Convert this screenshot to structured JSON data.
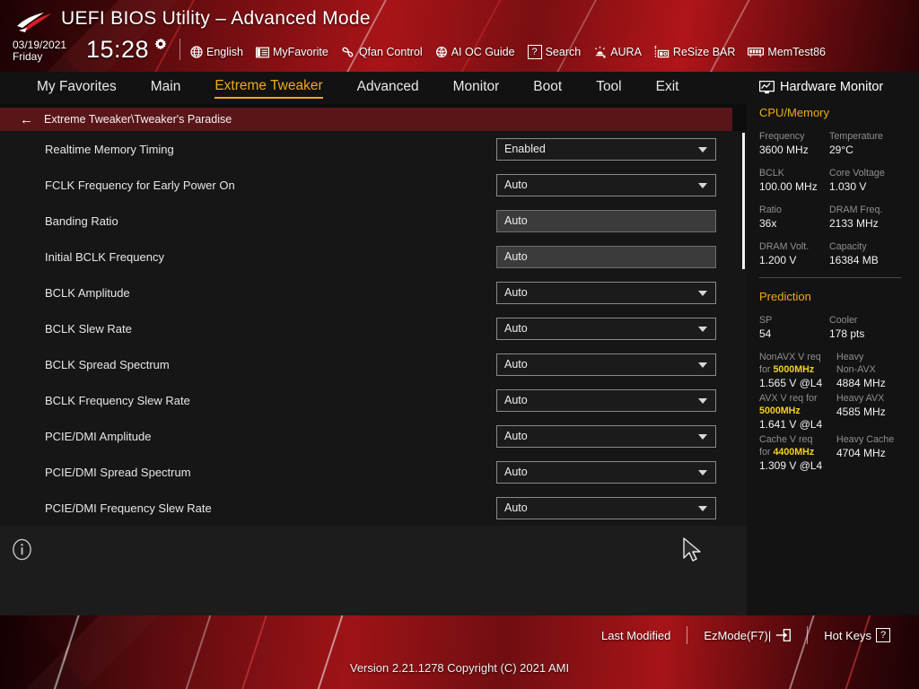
{
  "header": {
    "title": "UEFI BIOS Utility – Advanced Mode",
    "date": "03/19/2021",
    "weekday": "Friday",
    "time": "15:28",
    "logo_name": "rog-logo",
    "gear_icon": "gear-icon",
    "toolbar": [
      {
        "label": "English",
        "icon": "globe-icon"
      },
      {
        "label": "MyFavorite",
        "icon": "favorites-list-icon"
      },
      {
        "label": "Qfan Control",
        "icon": "fan-icon"
      },
      {
        "label": "AI OC Guide",
        "icon": "ai-brain-icon"
      },
      {
        "label": "Search",
        "icon": "question-box-icon"
      },
      {
        "label": "AURA",
        "icon": "aura-lighting-icon"
      },
      {
        "label": "ReSize BAR",
        "icon": "resize-bar-icon"
      },
      {
        "label": "MemTest86",
        "icon": "memory-icon"
      }
    ]
  },
  "nav": {
    "items": [
      {
        "label": "My Favorites",
        "active": false
      },
      {
        "label": "Main",
        "active": false
      },
      {
        "label": "Extreme Tweaker",
        "active": true
      },
      {
        "label": "Advanced",
        "active": false
      },
      {
        "label": "Monitor",
        "active": false
      },
      {
        "label": "Boot",
        "active": false
      },
      {
        "label": "Tool",
        "active": false
      },
      {
        "label": "Exit",
        "active": false
      }
    ],
    "active_color": "#f0a91e"
  },
  "breadcrumb": {
    "back_icon": "back-arrow-icon",
    "path": "Extreme Tweaker\\Tweaker's Paradise"
  },
  "settings": {
    "rows": [
      {
        "label": "Realtime Memory Timing",
        "value": "Enabled",
        "type": "select"
      },
      {
        "label": "FCLK Frequency for Early Power On",
        "value": "Auto",
        "type": "select"
      },
      {
        "label": "Banding Ratio",
        "value": "Auto",
        "type": "input"
      },
      {
        "label": "Initial BCLK Frequency",
        "value": "Auto",
        "type": "input"
      },
      {
        "label": "BCLK Amplitude",
        "value": "Auto",
        "type": "select"
      },
      {
        "label": "BCLK Slew Rate",
        "value": "Auto",
        "type": "select"
      },
      {
        "label": "BCLK Spread Spectrum",
        "value": "Auto",
        "type": "select"
      },
      {
        "label": "BCLK Frequency Slew Rate",
        "value": "Auto",
        "type": "select"
      },
      {
        "label": "PCIE/DMI Amplitude",
        "value": "Auto",
        "type": "select"
      },
      {
        "label": "PCIE/DMI Spread Spectrum",
        "value": "Auto",
        "type": "select"
      },
      {
        "label": "PCIE/DMI Frequency Slew Rate",
        "value": "Auto",
        "type": "select"
      }
    ]
  },
  "help": {
    "info_icon": "info-circle-icon",
    "cursor_icon": "mouse-cursor-icon"
  },
  "sidebar": {
    "title": "Hardware Monitor",
    "title_icon": "monitor-icon",
    "sections": [
      {
        "name": "CPU/Memory",
        "pairs": [
          [
            {
              "key": "Frequency",
              "value": "3600 MHz"
            },
            {
              "key": "Temperature",
              "value": "29°C"
            }
          ],
          [
            {
              "key": "BCLK",
              "value": "100.00 MHz"
            },
            {
              "key": "Core Voltage",
              "value": "1.030 V"
            }
          ],
          [
            {
              "key": "Ratio",
              "value": "36x"
            },
            {
              "key": "DRAM Freq.",
              "value": "2133 MHz"
            }
          ],
          [
            {
              "key": "DRAM Volt.",
              "value": "1.200 V"
            },
            {
              "key": "Capacity",
              "value": "16384 MB"
            }
          ]
        ]
      }
    ],
    "prediction": {
      "name": "Prediction",
      "pairs": [
        [
          {
            "key": "SP",
            "value": "54"
          },
          {
            "key": "Cooler",
            "value": "178 pts"
          }
        ]
      ],
      "blocks": [
        {
          "left_pre": "NonAVX V req",
          "left_for": "for ",
          "left_hl": "5000MHz",
          "left_value": "1.565 V @L4",
          "right_key_1": "Heavy",
          "right_key_2": "Non-AVX",
          "right_value": "4884 MHz"
        },
        {
          "left_pre": "AVX V req    for",
          "left_for": "",
          "left_hl": "5000MHz",
          "left_value": "1.641 V @L4",
          "right_key_1": "Heavy AVX",
          "right_key_2": "",
          "right_value": "4585 MHz"
        },
        {
          "left_pre": "Cache V req",
          "left_for": "for ",
          "left_hl": "4400MHz",
          "left_value": "1.309 V @L4",
          "right_key_1": "Heavy Cache",
          "right_key_2": "",
          "right_value": "4704 MHz"
        }
      ]
    },
    "accent_color": "#f0a91e",
    "highlight_color": "#f2d024"
  },
  "footer": {
    "last_modified": "Last Modified",
    "ez_mode": "EzMode(F7)|",
    "ez_mode_icon": "enter-arrow-icon",
    "hot_keys": "Hot Keys",
    "hot_keys_icon": "question-box-icon",
    "version": "Version 2.21.1278 Copyright (C) 2021 AMI"
  }
}
